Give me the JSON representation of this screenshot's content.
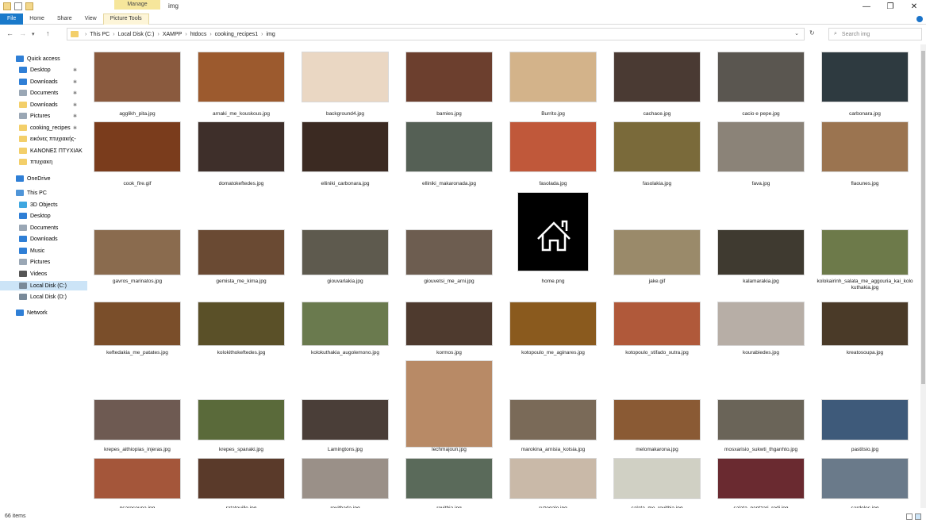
{
  "titlebar": {
    "manage_label": "Manage",
    "title": "img",
    "minimize": "—",
    "maximize": "❐",
    "close": "✕"
  },
  "ribbon": {
    "tabs": [
      "File",
      "Home",
      "Share",
      "View",
      "Picture Tools"
    ]
  },
  "address": {
    "back": "←",
    "forward": "→",
    "recent": "▾",
    "up": "↑",
    "crumbs": [
      "This PC",
      "Local Disk (C:)",
      "XAMPP",
      "htdocs",
      "cooking_recipes1",
      "img"
    ],
    "dropdown": "⌄",
    "refresh": "↻",
    "search_placeholder": "Search img"
  },
  "navpane": {
    "items": [
      {
        "label": "Quick access",
        "icon": "star-icon",
        "color": "#2f7fd6"
      },
      {
        "label": "Desktop",
        "icon": "desktop-icon",
        "color": "#2f7fd6",
        "pin": true
      },
      {
        "label": "Downloads",
        "icon": "download-icon",
        "color": "#2f7fd6",
        "pin": true
      },
      {
        "label": "Documents",
        "icon": "documents-icon",
        "color": "#9aa7b5",
        "pin": true
      },
      {
        "label": "Downloads",
        "icon": "folder-icon",
        "color": "#f3cf6a",
        "pin": true
      },
      {
        "label": "Pictures",
        "icon": "pictures-icon",
        "color": "#9aa7b5",
        "pin": true
      },
      {
        "label": "cooking_recipes",
        "icon": "folder-icon",
        "color": "#f3cf6a",
        "pin": true
      },
      {
        "label": "εικόνες πτυχιακής-",
        "icon": "folder-icon",
        "color": "#f3cf6a"
      },
      {
        "label": "ΚΑΝΟΝΕΣ ΠΤΥΧΙΑΚ",
        "icon": "folder-icon",
        "color": "#f3cf6a"
      },
      {
        "label": "πτυχιακη",
        "icon": "folder-icon",
        "color": "#f3cf6a"
      },
      {
        "label": "OneDrive",
        "icon": "cloud-icon",
        "color": "#2f7fd6"
      },
      {
        "label": "This PC",
        "icon": "computer-icon",
        "color": "#4f95d8"
      },
      {
        "label": "3D Objects",
        "icon": "cube-icon",
        "color": "#3fa7e0"
      },
      {
        "label": "Desktop",
        "icon": "desktop-icon",
        "color": "#2f7fd6"
      },
      {
        "label": "Documents",
        "icon": "documents-icon",
        "color": "#9aa7b5"
      },
      {
        "label": "Downloads",
        "icon": "download-icon",
        "color": "#2f7fd6"
      },
      {
        "label": "Music",
        "icon": "music-icon",
        "color": "#2f7fd6"
      },
      {
        "label": "Pictures",
        "icon": "pictures-icon",
        "color": "#9aa7b5"
      },
      {
        "label": "Videos",
        "icon": "video-icon",
        "color": "#555555"
      },
      {
        "label": "Local Disk (C:)",
        "icon": "drive-icon",
        "color": "#7a8a99",
        "selected": true
      },
      {
        "label": "Local Disk (D:)",
        "icon": "drive-icon",
        "color": "#7a8a99"
      },
      {
        "label": "Network",
        "icon": "network-icon",
        "color": "#2f7fd6"
      }
    ]
  },
  "files": [
    {
      "name": "agglikh_pita.jpg",
      "color": "#8a5a3e"
    },
    {
      "name": "arnaki_me_kouskous.jpg",
      "color": "#9c5a2e"
    },
    {
      "name": "background4.jpg",
      "color": "#ead7c3"
    },
    {
      "name": "bamies.jpg",
      "color": "#6c3f2e"
    },
    {
      "name": "Burrito.jpg",
      "color": "#d3b38a"
    },
    {
      "name": "cachace.jpg",
      "color": "#4a3a33"
    },
    {
      "name": "cacio e pepe.jpg",
      "color": "#5a5650"
    },
    {
      "name": "carbonara.jpg",
      "color": "#2e3a40"
    },
    {
      "name": "cook_fire.gif",
      "color": "#7a3c1c"
    },
    {
      "name": "domatokeftedes.jpg",
      "color": "#3e2f2a"
    },
    {
      "name": "elliniki_carbonara.jpg",
      "color": "#3b2a22"
    },
    {
      "name": "elliniki_makaronada.jpg",
      "color": "#556055"
    },
    {
      "name": "fasolada.jpg",
      "color": "#c0583a"
    },
    {
      "name": "fasolakia.jpg",
      "color": "#7a6a3a"
    },
    {
      "name": "fava.jpg",
      "color": "#8b8378"
    },
    {
      "name": "flaounes.jpg",
      "color": "#9b7450"
    },
    {
      "name": "gavros_marinatos.jpg",
      "color": "#8a6b4e"
    },
    {
      "name": "gemista_me_kima.jpg",
      "color": "#6a4a33"
    },
    {
      "name": "giouvarlakia.jpg",
      "color": "#5e5a4e"
    },
    {
      "name": "giouvetsi_me_arni.jpg",
      "color": "#6d5d50"
    },
    {
      "name": "home.png",
      "color": "#000000"
    },
    {
      "name": "jake.gif",
      "color": "#9a8a6a"
    },
    {
      "name": "kalamarakia.jpg",
      "color": "#3f3a30"
    },
    {
      "name": "kolokairinh_salata_me_aggouria_kai_kolokuthakia.jpg",
      "color": "#6d7a4a"
    },
    {
      "name": "keftedakia_me_patates.jpg",
      "color": "#7a4e2a"
    },
    {
      "name": "kolokithokeftedes.jpg",
      "color": "#5a5028"
    },
    {
      "name": "kolokuthakia_augolemono.jpg",
      "color": "#6a7a4e"
    },
    {
      "name": "kormos.jpg",
      "color": "#4e3a2e"
    },
    {
      "name": "kotopoulo_me_aginares.jpg",
      "color": "#8a5a1e"
    },
    {
      "name": "kotopoulo_stifado_xutra.jpg",
      "color": "#b0593a"
    },
    {
      "name": "kourabiedes.jpg",
      "color": "#b7aea6"
    },
    {
      "name": "kreatosoupa.jpg",
      "color": "#4a3a28"
    },
    {
      "name": "krepes_aithiopias_injeras.jpg",
      "color": "#6e5a52"
    },
    {
      "name": "krepes_spanaki.jpg",
      "color": "#5a6a3a"
    },
    {
      "name": "Lamingtons.jpg",
      "color": "#4a3e38"
    },
    {
      "name": "lechmajoun.jpg",
      "color": "#b88a66"
    },
    {
      "name": "marokina_arnisia_kotsia.jpg",
      "color": "#7a6a58"
    },
    {
      "name": "melomakarona.jpg",
      "color": "#8a5a34"
    },
    {
      "name": "mosxarisio_sukwti_thganhto.jpg",
      "color": "#6a6458"
    },
    {
      "name": "pastitsio.jpg",
      "color": "#3e5a7a"
    },
    {
      "name": "psarosoupa.jpg",
      "color": "#a4563a"
    },
    {
      "name": "ratatouille.jpg",
      "color": "#5a3a2a"
    },
    {
      "name": "revithada.jpg",
      "color": "#9a9088"
    },
    {
      "name": "revithia.jpg",
      "color": "#5a6a5a"
    },
    {
      "name": "ruzogalo.jpg",
      "color": "#c9b9a8"
    },
    {
      "name": "salata_me_revithia.jpg",
      "color": "#d0d0c4"
    },
    {
      "name": "salata_pantzari_rodi.jpg",
      "color": "#6a2a30"
    },
    {
      "name": "sardeles.jpg",
      "color": "#6a7a8a"
    }
  ],
  "status": {
    "count": "66 items"
  }
}
